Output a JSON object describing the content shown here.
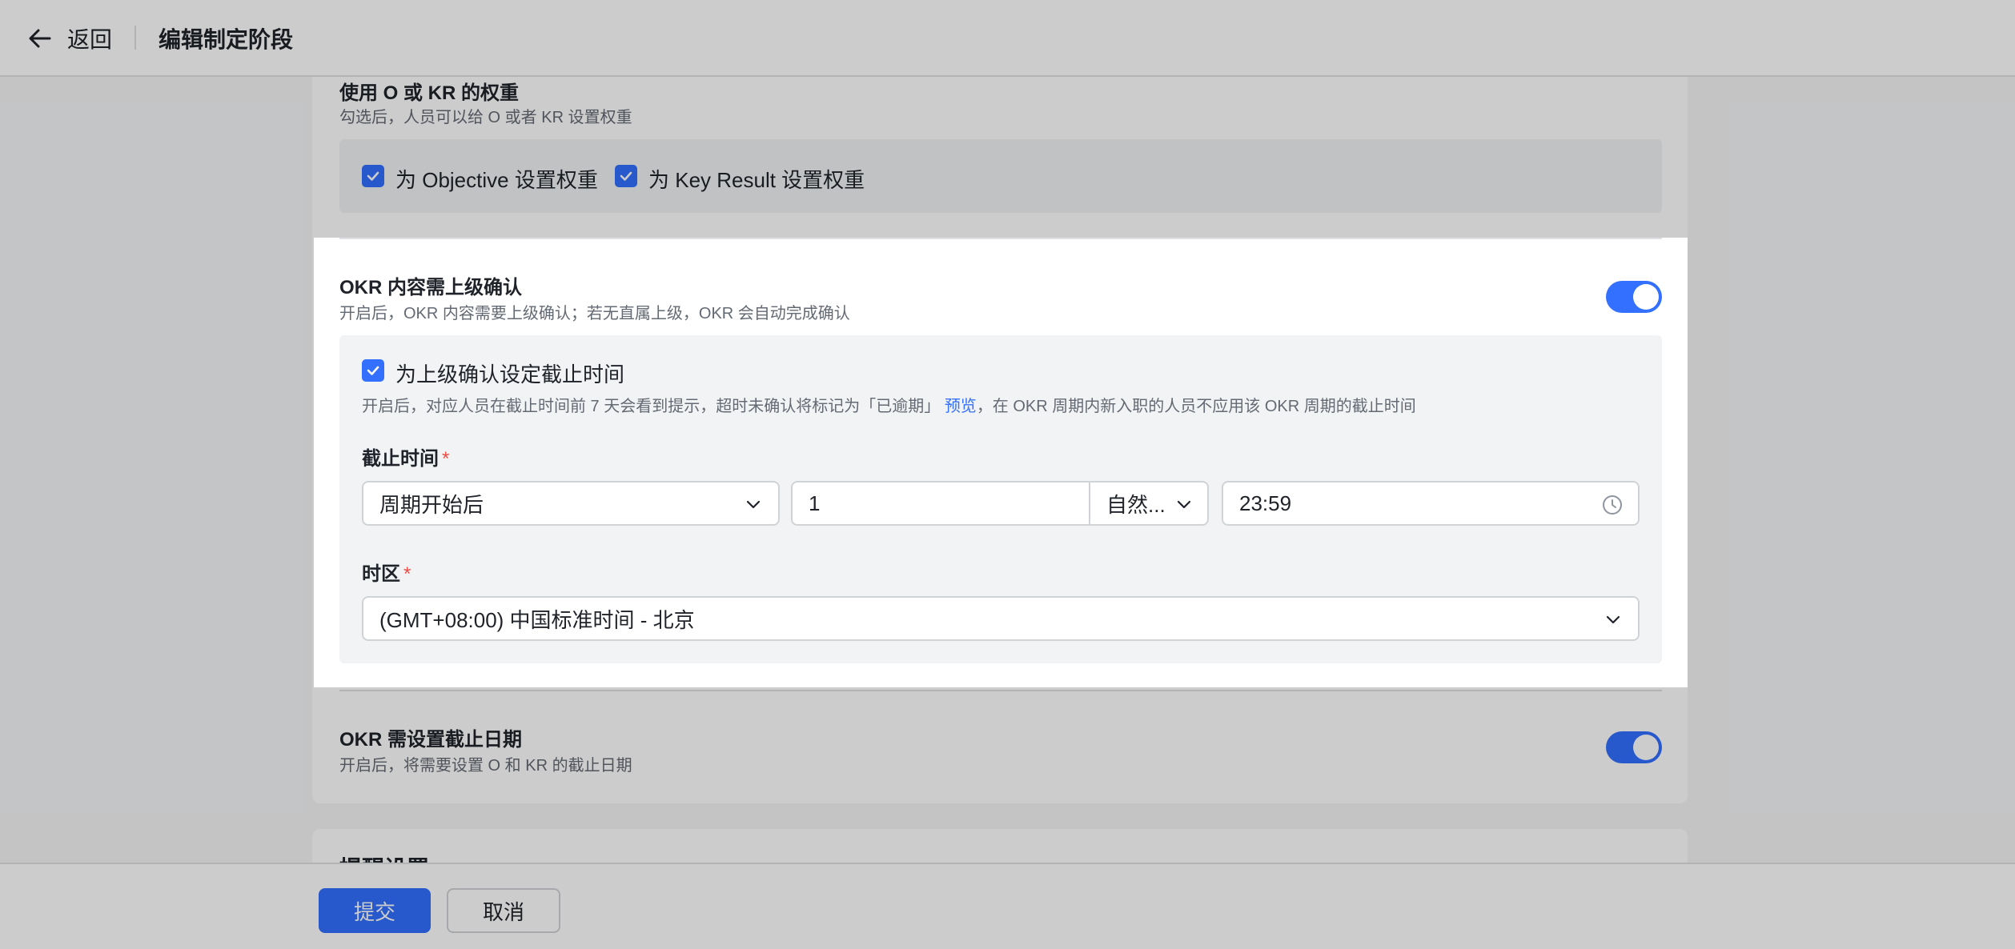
{
  "topbar": {
    "back_label": "返回",
    "title": "编辑制定阶段"
  },
  "weight_section": {
    "title": "使用 O 或 KR 的权重",
    "desc": "勾选后，人员可以给 O 或者 KR 设置权重",
    "options": [
      {
        "label": "为 Objective 设置权重",
        "checked": true
      },
      {
        "label": "为 Key Result 设置权重",
        "checked": true
      }
    ]
  },
  "confirm_section": {
    "title": "OKR 内容需上级确认",
    "desc": "开启后，OKR 内容需要上级确认；若无直属上级，OKR 会自动完成确认",
    "enabled": true,
    "deadline_checkbox": {
      "label": "为上级确认设定截止时间",
      "checked": true
    },
    "deadline_desc_before": "开启后，对应人员在截止时间前 7 天会看到提示，超时未确认将标记为「已逾期」",
    "deadline_desc_link": "预览",
    "deadline_desc_after": "，在 OKR 周期内新入职的人员不应用该 OKR 周期的截止时间",
    "deadline_label": "截止时间",
    "required_mark": "*",
    "deadline_anchor": "周期开始后",
    "deadline_amount": "1",
    "deadline_unit": "自然...",
    "deadline_time": "23:59",
    "timezone_label": "时区",
    "timezone_value": "(GMT+08:00) 中国标准时间 - 北京"
  },
  "due_section": {
    "title": "OKR 需设置截止日期",
    "desc": "开启后，将需要设置 O 和 KR 的截止日期",
    "enabled": true
  },
  "next_section": {
    "title": "提醒设置"
  },
  "footer": {
    "submit_label": "提交",
    "cancel_label": "取消"
  },
  "colors": {
    "accent": "#3370ff",
    "required": "#f54a45"
  }
}
